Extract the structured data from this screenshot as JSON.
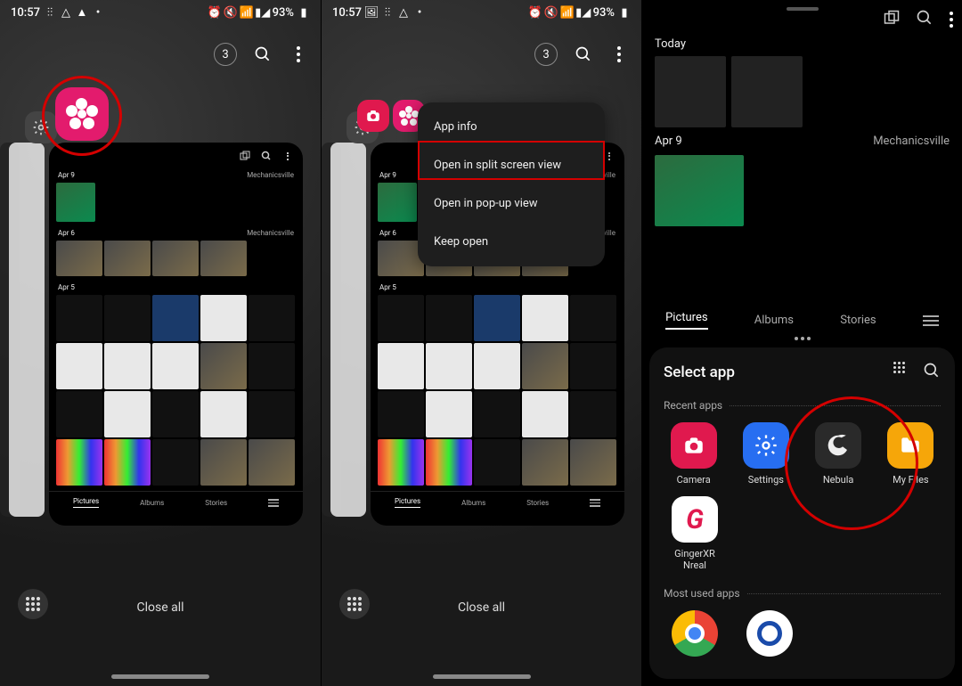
{
  "status": {
    "time": "10:57",
    "battery": "93%"
  },
  "recents": {
    "open_count": "3",
    "close_all": "Close all"
  },
  "context_menu": {
    "app_info": "App info",
    "split_screen": "Open in split screen view",
    "popup": "Open in pop-up view",
    "keep_open": "Keep open"
  },
  "gallery_preview": {
    "dates": {
      "d1": "Apr 9",
      "d2": "Apr 6",
      "d3": "Apr 5"
    },
    "location": "Mechanicsville",
    "tabs": {
      "pictures": "Pictures",
      "albums": "Albums",
      "stories": "Stories"
    }
  },
  "gallery_full": {
    "today": "Today",
    "date": "Apr 9",
    "location": "Mechanicsville",
    "tabs": {
      "pictures": "Pictures",
      "albums": "Albums",
      "stories": "Stories"
    }
  },
  "select_app": {
    "title": "Select app",
    "recent_label": "Recent apps",
    "most_used_label": "Most used apps",
    "apps": {
      "camera": "Camera",
      "settings": "Settings",
      "nebula": "Nebula",
      "files": "My Files",
      "ginger": "GingerXR Nreal"
    }
  }
}
